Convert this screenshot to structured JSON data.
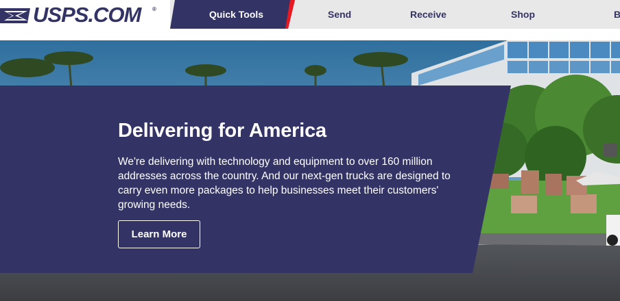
{
  "brand": {
    "name": "USPS.COM",
    "registered": "®"
  },
  "nav": {
    "items": [
      {
        "label": "Quick Tools",
        "active": true
      },
      {
        "label": "Send",
        "active": false
      },
      {
        "label": "Receive",
        "active": false
      },
      {
        "label": "Shop",
        "active": false
      },
      {
        "label": "B",
        "active": false
      }
    ]
  },
  "hero": {
    "title": "Delivering for America",
    "body": "We're delivering with technology and equipment to over 160 million addresses across the country. And our next-gen trucks are designed to carry even more packages to help businesses meet their customers' growing needs.",
    "cta_label": "Learn More"
  },
  "colors": {
    "brand_navy": "#333366",
    "accent_red": "#e71921",
    "nav_background": "#e8e8e8",
    "panel_background": "#333366"
  }
}
